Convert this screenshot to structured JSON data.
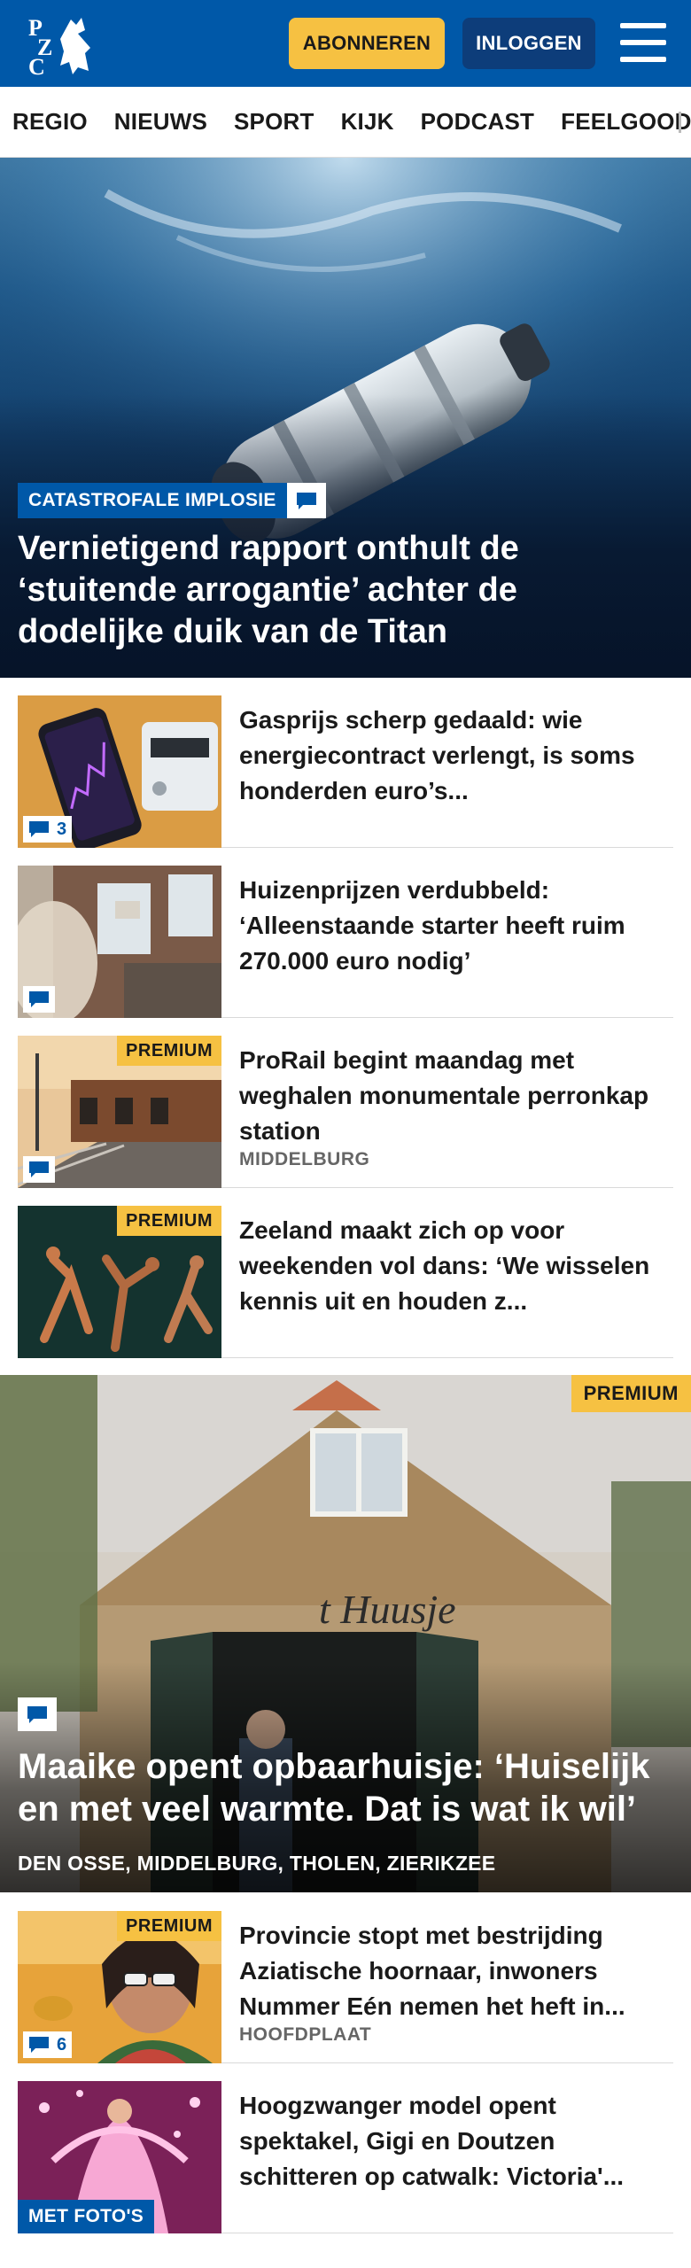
{
  "header": {
    "logo_text": "PZC",
    "subscribe_label": "ABONNEREN",
    "login_label": "INLOGGEN",
    "brand_color": "#0058a8",
    "accent_color": "#f6c142"
  },
  "nav": {
    "items": [
      {
        "label": "REGIO"
      },
      {
        "label": "NIEUWS"
      },
      {
        "label": "SPORT"
      },
      {
        "label": "KIJK"
      },
      {
        "label": "PODCAST"
      },
      {
        "label": "FEELGOOD"
      }
    ]
  },
  "hero": {
    "tag": "CATASTROFALE IMPLOSIE",
    "title": "Vernietigend rapport onthult de ‘stuitende arrogantie’ achter de dodelijke duik van de Titan",
    "icon": "comment-icon"
  },
  "articles": [
    {
      "title": "Gasprijs scherp gedaald: wie energiecontract verlengt, is soms honderden euro’s...",
      "comments": "3"
    },
    {
      "title": "Huizenprijzen verdubbeld: ‘Alleenstaande starter heeft ruim 270.000 euro nodig’"
    },
    {
      "title": "ProRail begint maandag met weghalen monumentale perronkap station",
      "location": "MIDDELBURG",
      "badge": "PREMIUM"
    },
    {
      "title": "Zeeland maakt zich op voor weekenden vol dans: ‘We wisselen kennis uit en houden z...",
      "badge": "PREMIUM"
    }
  ],
  "feature": {
    "badge": "PREMIUM",
    "title": "Maaike opent opbaarhuisje: ‘Huiselijk en met veel warmte. Dat is wat ik wil’",
    "locations": "DEN OSSE, MIDDELBURG, THOLEN, ZIERIKZEE",
    "sign_text": "t Huusje"
  },
  "articles2": [
    {
      "title": "Provincie stopt met bestrijding Aziatische hoornaar, inwoners Nummer Eén nemen het heft in...",
      "location": "HOOFDPLAAT",
      "badge": "PREMIUM",
      "comments": "6"
    },
    {
      "title": "Hoogzwanger model opent spektakel, Gigi en Doutzen schitteren op catwalk: Victoria'...",
      "badge": "MET FOTO'S"
    }
  ]
}
